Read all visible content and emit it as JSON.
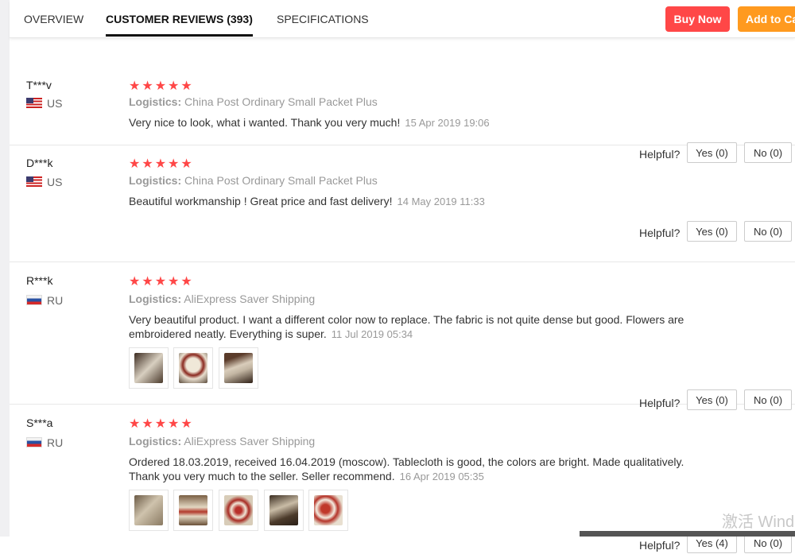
{
  "tabs": [
    {
      "label": "OVERVIEW"
    },
    {
      "label": "CUSTOMER REVIEWS (393)"
    },
    {
      "label": "SPECIFICATIONS"
    }
  ],
  "actions": {
    "buy_now": "Buy Now",
    "add_to_cart": "Add to Ca"
  },
  "reviews": [
    {
      "user": "T***v",
      "country": "US",
      "stars": "★★★★★",
      "logistics_label": "Logistics:",
      "logistics": "China Post Ordinary Small Packet Plus",
      "text": "Very nice to look, what i wanted. Thank you very much!",
      "date": "15 Apr 2019 19:06",
      "helpful": "Helpful?",
      "yes": "Yes (0)",
      "no": "No (0)"
    },
    {
      "user": "D***k",
      "country": "US",
      "stars": "★★★★★",
      "logistics_label": "Logistics:",
      "logistics": "China Post Ordinary Small Packet Plus",
      "text": "Beautiful workmanship ! Great price and fast delivery!",
      "date": "14 May 2019 11:33",
      "helpful": "Helpful?",
      "yes": "Yes (0)",
      "no": "No (0)"
    },
    {
      "user": "R***k",
      "country": "RU",
      "stars": "★★★★★",
      "logistics_label": "Logistics:",
      "logistics": "AliExpress Saver Shipping",
      "text": "Very beautiful product. I want a different color now to replace. The fabric is not quite dense but good. Flowers are embroidered neatly. Everything is super.",
      "date": "11 Jul 2019 05:34",
      "helpful": "Helpful?",
      "yes": "Yes (0)",
      "no": "No (0)",
      "photos": 3
    },
    {
      "user": "S***a",
      "country": "RU",
      "stars": "★★★★★",
      "logistics_label": "Logistics:",
      "logistics": "AliExpress Saver Shipping",
      "text": "Ordered 18.03.2019, received 16.04.2019 (moscow). Tablecloth is good, the colors are bright. Made qualitatively. Thank you very much to the seller. Seller recommend.",
      "date": "16 Apr 2019 05:35",
      "helpful": "Helpful?",
      "yes": "Yes (4)",
      "no": "No (0)",
      "photos": 5
    }
  ],
  "watermark": "激活 Windo"
}
